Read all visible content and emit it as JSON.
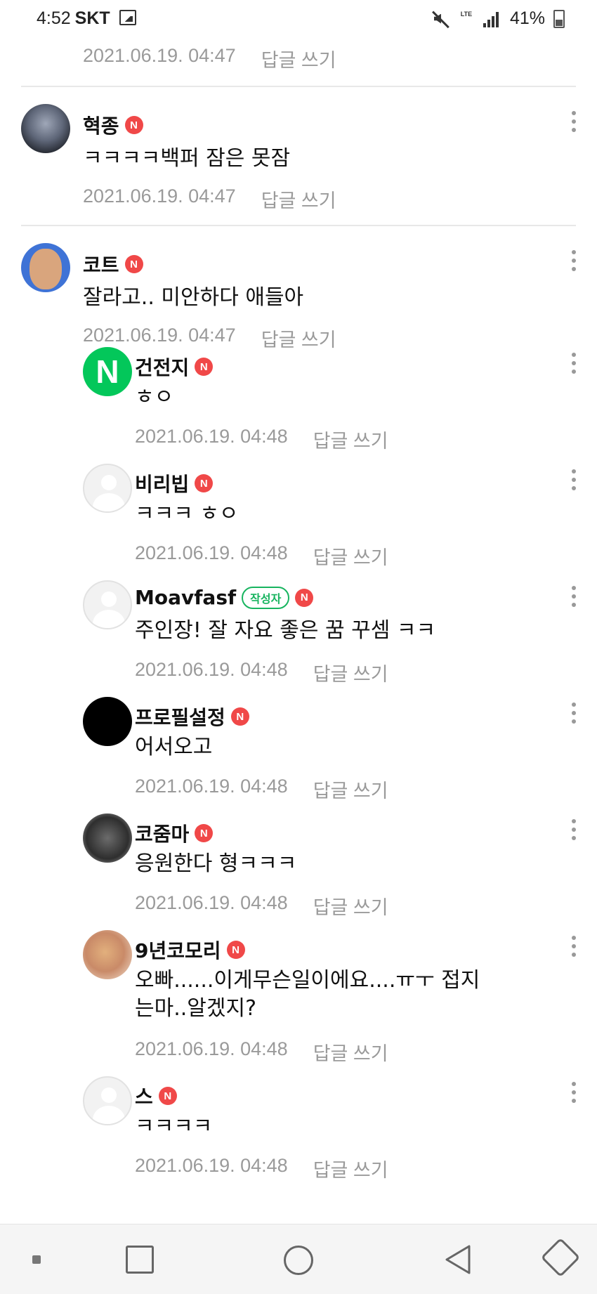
{
  "status_bar": {
    "time": "4:52",
    "carrier": "SKT",
    "lte_label": "LTE",
    "battery_percent": "41%"
  },
  "comments": [
    {
      "date": "2021.06.19. 04:47",
      "reply": "답글 쓰기"
    },
    {
      "name": "혁종",
      "badge": "N",
      "text": "ㅋㅋㅋㅋ백퍼 잠은 못잠",
      "date": "2021.06.19. 04:47",
      "reply": "답글 쓰기"
    },
    {
      "name": "코트",
      "badge": "N",
      "text": "잘라고.. 미안하다 애들아",
      "date": "2021.06.19. 04:47",
      "reply": "답글 쓰기"
    }
  ],
  "replies": [
    {
      "name": "건전지",
      "badge": "N",
      "avatar_letter": "N",
      "text": "ㅎㅇ",
      "date": "2021.06.19. 04:48",
      "reply": "답글 쓰기"
    },
    {
      "name": "비리빕",
      "badge": "N",
      "text": "ㅋㅋㅋ ㅎㅇ",
      "date": "2021.06.19. 04:48",
      "reply": "답글 쓰기"
    },
    {
      "name": "Moavfasf",
      "author_badge": "작성자",
      "badge": "N",
      "text": "주인장! 잘 자요 좋은 꿈 꾸셈 ㅋㅋ",
      "date": "2021.06.19. 04:48",
      "reply": "답글 쓰기"
    },
    {
      "name": "프로필설정",
      "badge": "N",
      "text": "어서오고",
      "date": "2021.06.19. 04:48",
      "reply": "답글 쓰기"
    },
    {
      "name": "코줌마",
      "badge": "N",
      "text": "응원한다 형ㅋㅋㅋ",
      "date": "2021.06.19. 04:48",
      "reply": "답글 쓰기"
    },
    {
      "name": "9년코모리",
      "badge": "N",
      "text_line1": "오빠......이게무슨일이에요....ㅠㅜ 접지",
      "text_line2": "는마..알겠지?",
      "date": "2021.06.19. 04:48",
      "reply": "답글 쓰기"
    },
    {
      "name": "스",
      "badge": "N",
      "text": "ㅋㅋㅋㅋ",
      "date": "2021.06.19. 04:48",
      "reply": "답글 쓰기"
    }
  ]
}
